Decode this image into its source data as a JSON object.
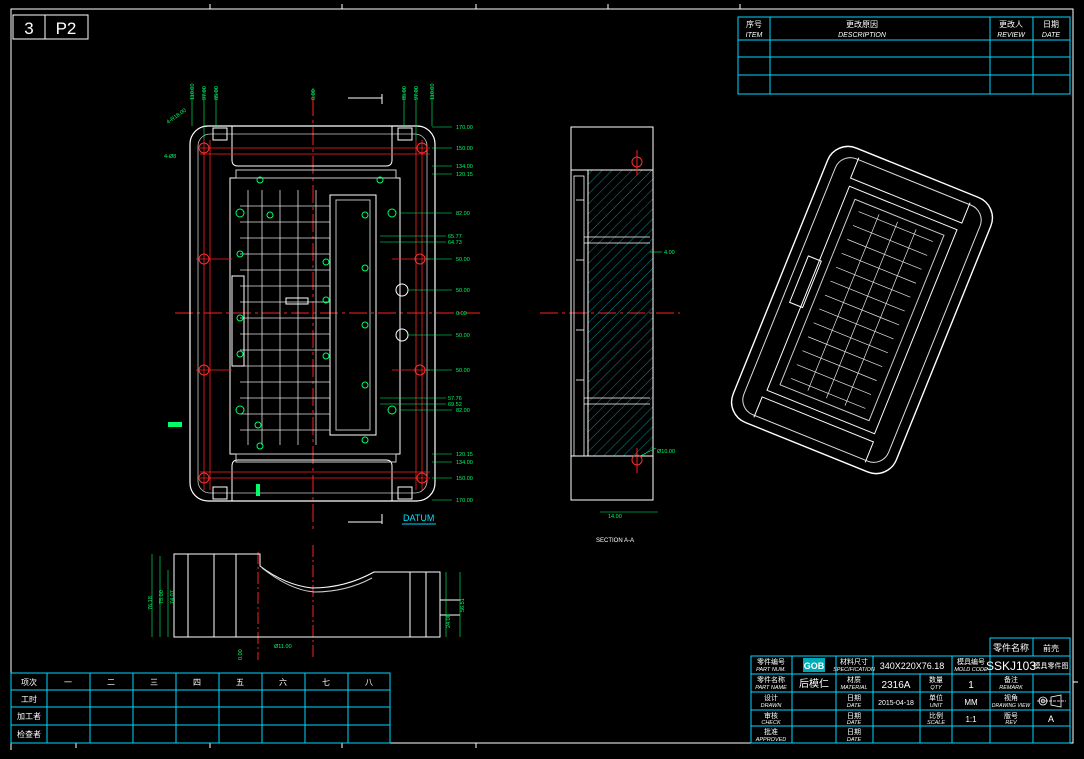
{
  "sheet": {
    "page_index": "3",
    "page_code": "P2"
  },
  "revision_block": {
    "col_item_cn": "序号",
    "col_item_en": "ITEM",
    "col_desc_cn": "更改原因",
    "col_desc_en": "DESCRIPTION",
    "col_review_cn": "更改人",
    "col_review_en": "REVIEW",
    "col_date_cn": "日期",
    "col_date_en": "DATE"
  },
  "title_block": {
    "part_name_header": "零件名称",
    "part_name_value": "前壳",
    "mold_code": "SSKJ103",
    "part_number_cn": "零件编号",
    "part_number_en": "PART NUM.",
    "logo_text": "GOB",
    "part_name_cn": "零件名称",
    "part_name_en": "PART NAME",
    "part_name_val": "后模仁",
    "spec_cn": "材料尺寸",
    "spec_en": "SPECIFICATION",
    "spec_val": "340X220X76.18",
    "mold_no_cn": "模具编号",
    "mold_no_en": "MOLD CODE",
    "sheet_type": "模具零件图",
    "material_cn": "材质",
    "material_en": "MATERIAL",
    "material_val": "2316A",
    "qty_cn": "数量",
    "qty_en": "QTY",
    "qty_val": "1",
    "remark_cn": "备注",
    "remark_en": "REMARK",
    "design_cn": "设计",
    "design_en": "DRAWN",
    "date_cn": "日期",
    "date_en": "DATE",
    "date_val": "2015-04-18",
    "unit_cn": "单位",
    "unit_en": "UNIT",
    "unit_val": "MM",
    "view_cn": "视角",
    "view_en": "DRAWING VIEW",
    "check_cn": "审核",
    "check_en": "CHECK",
    "scale_cn": "比例",
    "scale_en": "SCALE",
    "scale_val": "1:1",
    "rev_cn": "版号",
    "rev_en": "REV",
    "rev_val": "A",
    "approve_cn": "批准",
    "approve_en": "APPROVED"
  },
  "process_table": {
    "rows": [
      "项次",
      "工时",
      "加工者",
      "检查者"
    ],
    "cols": [
      "一",
      "二",
      "三",
      "四",
      "五",
      "六",
      "七",
      "八"
    ]
  },
  "labels": {
    "datum": "DATUM",
    "section": "SECTION A-A"
  },
  "dims_right": [
    "170.00",
    "150.00",
    "134.00",
    "120.15",
    "82.00",
    "65.77",
    "64.73",
    "50.00",
    "50.00",
    "0.00",
    "50.00",
    "50.00",
    "57.76",
    "69.52",
    "82.00",
    "120.15",
    "134.00",
    "150.00",
    "170.00"
  ],
  "dims_top": [
    "110.00",
    "97.00",
    "85.00",
    "0.00",
    "85.00",
    "97.00",
    "110.00"
  ],
  "dims_left": [
    "4-R18.00",
    "4-Ø8"
  ],
  "dims_section": [
    "4.00",
    "Ø10.00",
    "14.00"
  ],
  "dims_bottom_view": [
    "76.18",
    "75.00",
    "74.07",
    "24.00",
    "56.51",
    "0.00",
    "Ø11.00"
  ]
}
